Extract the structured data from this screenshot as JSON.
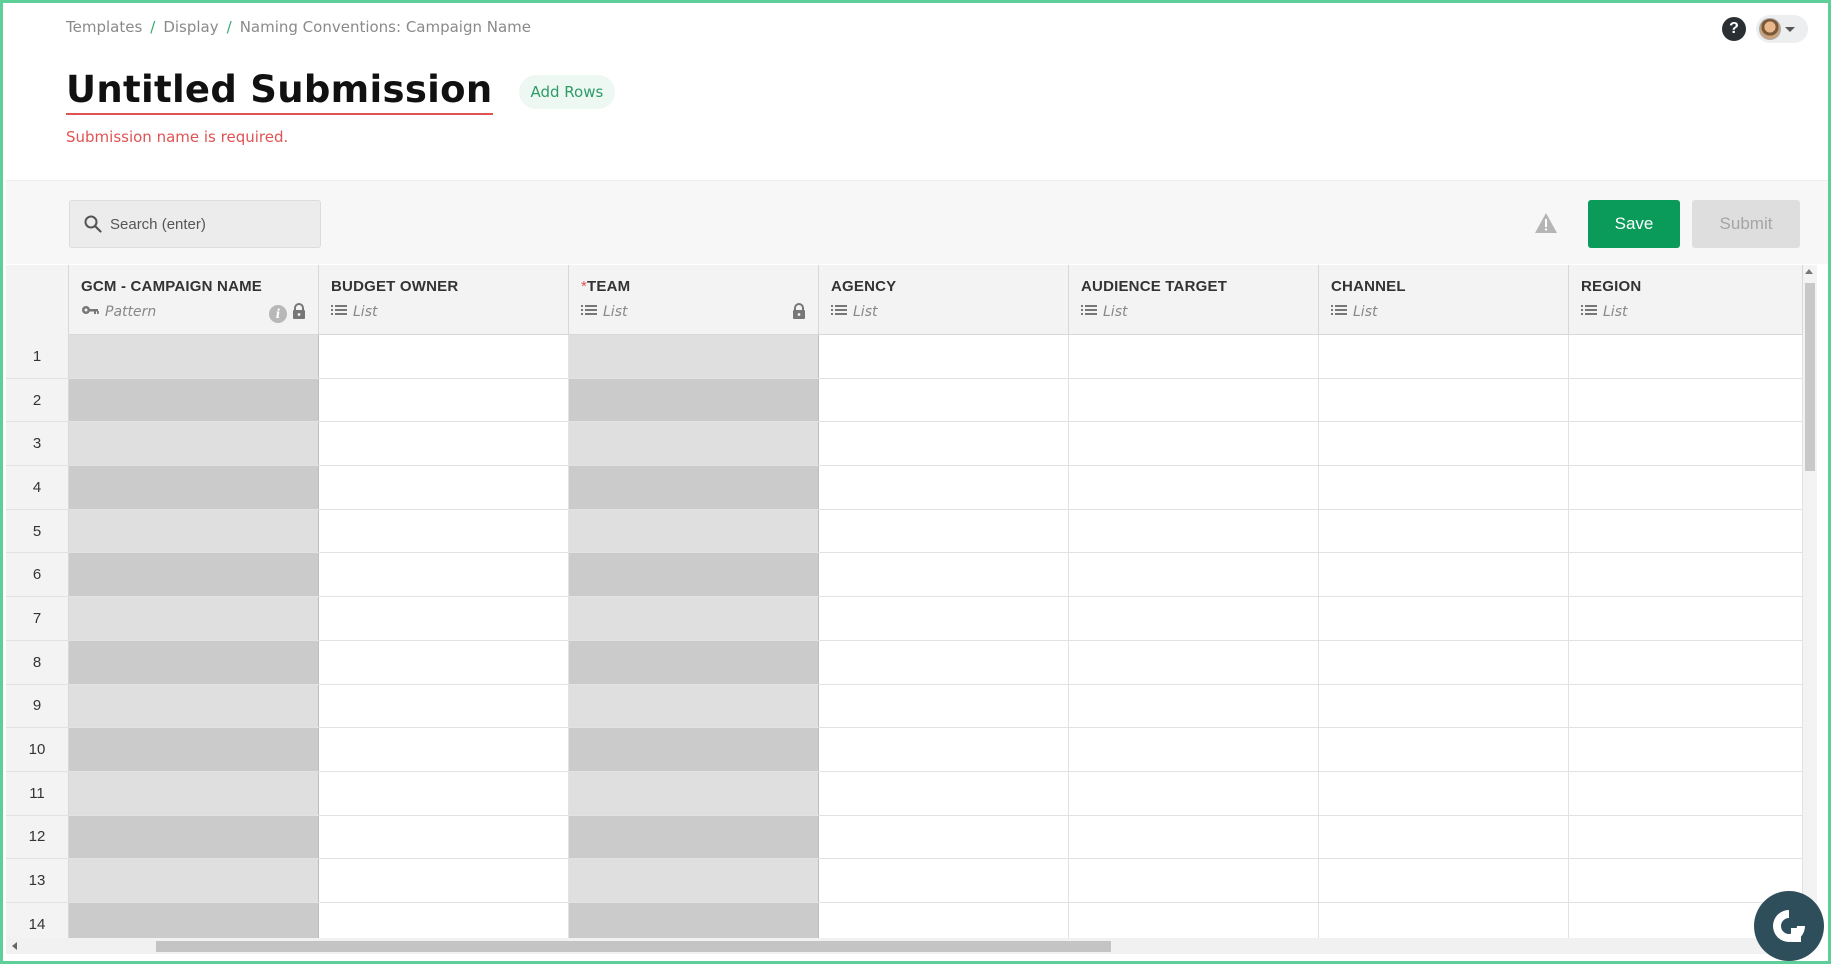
{
  "breadcrumb": [
    "Templates",
    "Display",
    "Naming Conventions: Campaign Name"
  ],
  "breadcrumb_sep": "/",
  "title": "Untitled Submission",
  "add_rows_label": "Add Rows",
  "error_message": "Submission name is required.",
  "search": {
    "placeholder": "Search (enter)"
  },
  "buttons": {
    "save": "Save",
    "submit": "Submit"
  },
  "colors": {
    "accent": "#0a9a5a",
    "error": "#e05353",
    "frame": "#5fcf9a"
  },
  "columns": [
    {
      "required_mark": "",
      "name": "GCM - CAMPAIGN NAME",
      "type": "Pattern",
      "type_icon": "key-icon",
      "locked": true,
      "info": true
    },
    {
      "required_mark": "",
      "name": "BUDGET OWNER",
      "type": "List",
      "type_icon": "list-icon",
      "locked": false,
      "info": false
    },
    {
      "required_mark": "*",
      "name": "TEAM",
      "type": "List",
      "type_icon": "list-icon",
      "locked": true,
      "info": false
    },
    {
      "required_mark": "",
      "name": "AGENCY",
      "type": "List",
      "type_icon": "list-icon",
      "locked": false,
      "info": false
    },
    {
      "required_mark": "",
      "name": "AUDIENCE TARGET",
      "type": "List",
      "type_icon": "list-icon",
      "locked": false,
      "info": false
    },
    {
      "required_mark": "",
      "name": "CHANNEL",
      "type": "List",
      "type_icon": "list-icon",
      "locked": false,
      "info": false
    },
    {
      "required_mark": "",
      "name": "REGION",
      "type": "List",
      "type_icon": "list-icon",
      "locked": false,
      "info": false
    }
  ],
  "row_numbers": [
    "1",
    "2",
    "3",
    "4",
    "5",
    "6",
    "7",
    "8",
    "9",
    "10",
    "11",
    "12",
    "13",
    "14"
  ]
}
